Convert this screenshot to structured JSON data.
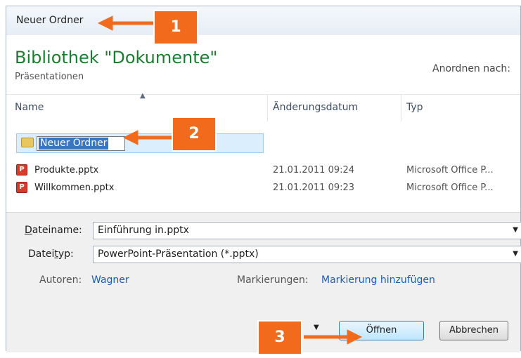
{
  "toolbar": {
    "new_folder_label": "Neuer Ordner"
  },
  "library": {
    "title": "Bibliothek \"Dokumente\"",
    "subtitle": "Präsentationen",
    "arrange_label": "Anordnen nach:"
  },
  "columns": {
    "name": "Name",
    "date": "Änderungsdatum",
    "type": "Typ"
  },
  "new_folder": {
    "editing_name": "Neuer Ordner"
  },
  "files": [
    {
      "name": "Produkte.pptx",
      "date": "21.01.2011 09:24",
      "type": "Microsoft Office P..."
    },
    {
      "name": "Willkommen.pptx",
      "date": "21.01.2011 09:23",
      "type": "Microsoft Office P..."
    }
  ],
  "form": {
    "filename_label_u": "D",
    "filename_label_rest": "ateiname:",
    "filename_value": "Einführung in.pptx",
    "filetype_label_a": "Datei",
    "filetype_label_u": "t",
    "filetype_label_b": "yp:",
    "filetype_value": "PowerPoint-Präsentation (*.pptx)",
    "authors_label": "Autoren:",
    "authors_value": "Wagner",
    "tags_label": "Markierungen:",
    "tags_value": "Markierung hinzufügen"
  },
  "buttons": {
    "open": "Öffnen",
    "cancel": "Abbrechen"
  },
  "callouts": [
    "1",
    "2",
    "3"
  ],
  "colors": {
    "callout": "#f26b1d",
    "library_title": "#1b7e2e",
    "link": "#1a5fb4",
    "selection": "#3a75c4"
  }
}
